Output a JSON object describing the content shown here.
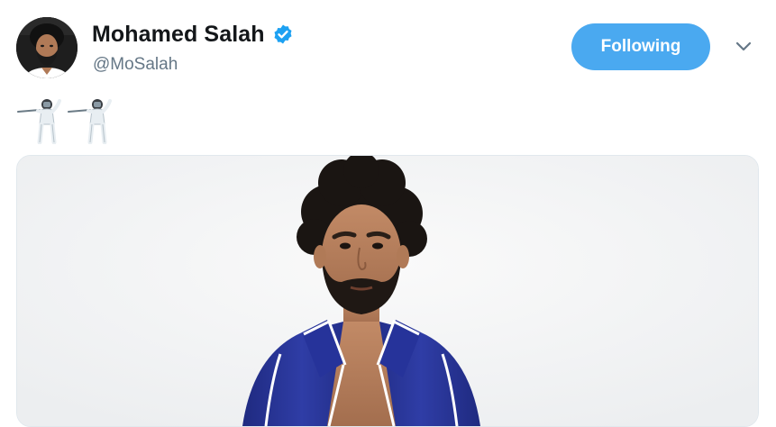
{
  "tweet": {
    "author": {
      "display_name": "Mohamed Salah",
      "handle": "@MoSalah",
      "verified": true,
      "avatar_icon": "profile-photo"
    },
    "follow_button": {
      "label": "Following",
      "color": "#4aa9f0"
    },
    "menu_icon": "chevron-down-icon",
    "text_emojis": [
      "person-fencing-emoji",
      "person-fencing-emoji"
    ],
    "media": {
      "type": "photo",
      "subject": "man-in-tracksuit-photo"
    }
  },
  "colors": {
    "accent": "#4aa9f0",
    "verified_badge": "#1da1f2",
    "handle_text": "#657786",
    "name_text": "#14171a",
    "card_border": "#e1e8ed"
  }
}
